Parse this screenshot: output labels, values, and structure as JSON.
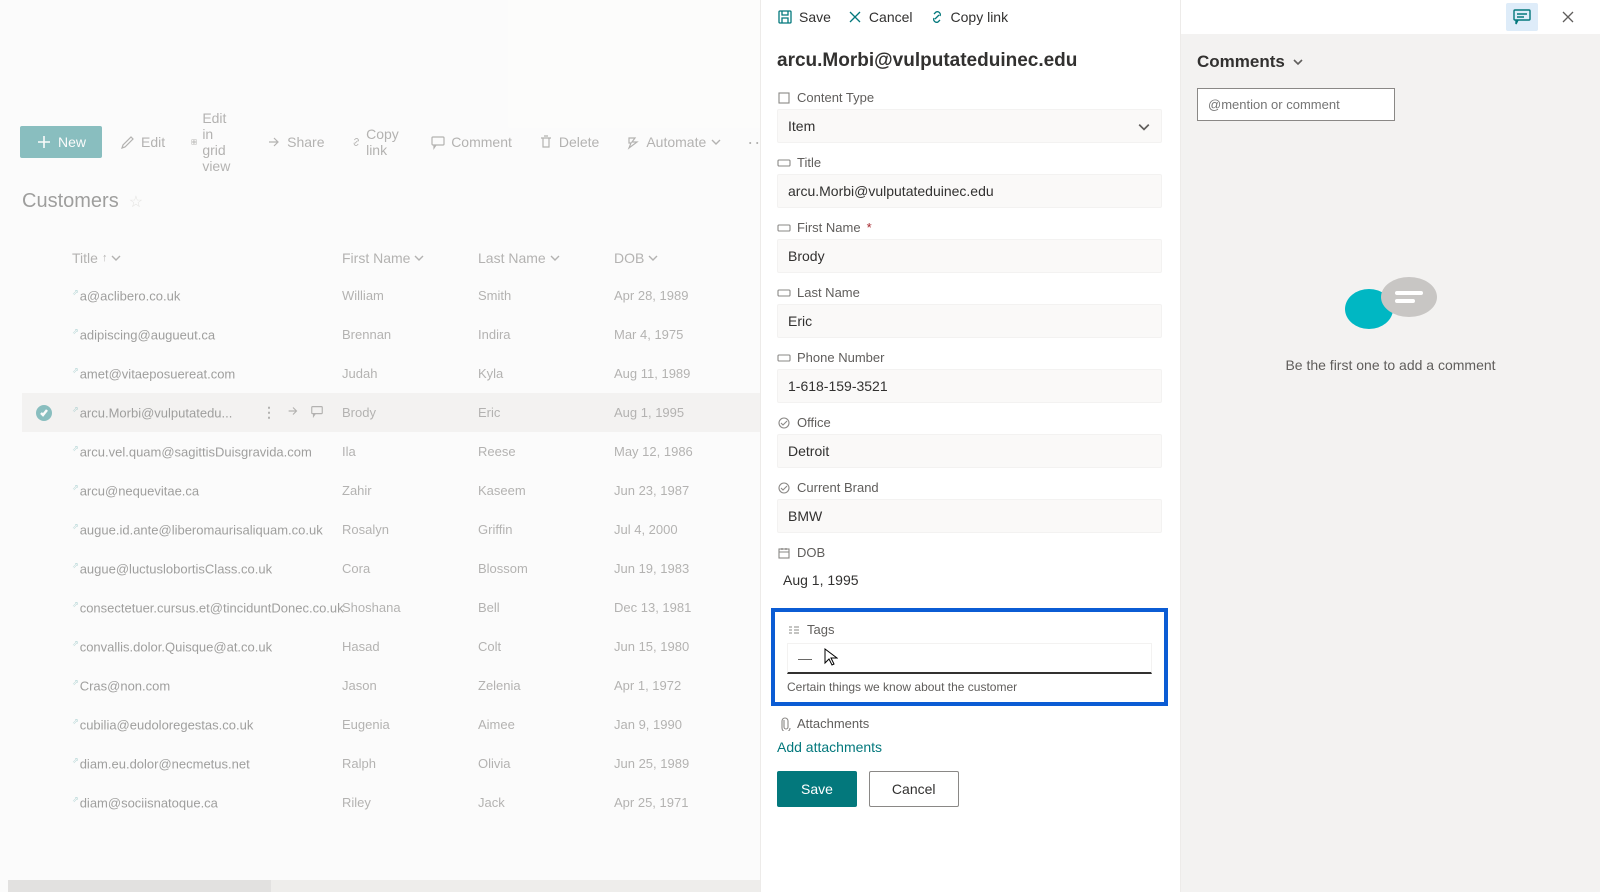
{
  "toolbar": {
    "new_label": "New",
    "edit_label": "Edit",
    "edit_grid_label": "Edit in grid view",
    "share_label": "Share",
    "copy_link_label": "Copy link",
    "comment_label": "Comment",
    "delete_label": "Delete",
    "automate_label": "Automate"
  },
  "list": {
    "title": "Customers",
    "columns": {
      "title": "Title",
      "first_name": "First Name",
      "last_name": "Last Name",
      "dob": "DOB"
    },
    "rows": [
      {
        "title": "a@aclibero.co.uk",
        "first": "William",
        "last": "Smith",
        "dob": "Apr 28, 1989"
      },
      {
        "title": "adipiscing@augueut.ca",
        "first": "Brennan",
        "last": "Indira",
        "dob": "Mar 4, 1975"
      },
      {
        "title": "amet@vitaeposuereat.com",
        "first": "Judah",
        "last": "Kyla",
        "dob": "Aug 11, 1989"
      },
      {
        "title": "arcu.Morbi@vulputatedu...",
        "first": "Brody",
        "last": "Eric",
        "dob": "Aug 1, 1995",
        "selected": true
      },
      {
        "title": "arcu.vel.quam@sagittisDuisgravida.com",
        "first": "Ila",
        "last": "Reese",
        "dob": "May 12, 1986"
      },
      {
        "title": "arcu@nequevitae.ca",
        "first": "Zahir",
        "last": "Kaseem",
        "dob": "Jun 23, 1987"
      },
      {
        "title": "augue.id.ante@liberomaurisaliquam.co.uk",
        "first": "Rosalyn",
        "last": "Griffin",
        "dob": "Jul 4, 2000"
      },
      {
        "title": "augue@luctuslobortisClass.co.uk",
        "first": "Cora",
        "last": "Blossom",
        "dob": "Jun 19, 1983"
      },
      {
        "title": "consectetuer.cursus.et@tinciduntDonec.co.uk",
        "first": "Shoshana",
        "last": "Bell",
        "dob": "Dec 13, 1981"
      },
      {
        "title": "convallis.dolor.Quisque@at.co.uk",
        "first": "Hasad",
        "last": "Colt",
        "dob": "Jun 15, 1980"
      },
      {
        "title": "Cras@non.com",
        "first": "Jason",
        "last": "Zelenia",
        "dob": "Apr 1, 1972"
      },
      {
        "title": "cubilia@eudoloregestas.co.uk",
        "first": "Eugenia",
        "last": "Aimee",
        "dob": "Jan 9, 1990"
      },
      {
        "title": "diam.eu.dolor@necmetus.net",
        "first": "Ralph",
        "last": "Olivia",
        "dob": "Jun 25, 1989"
      },
      {
        "title": "diam@sociisnatoque.ca",
        "first": "Riley",
        "last": "Jack",
        "dob": "Apr 25, 1971"
      }
    ]
  },
  "panel": {
    "top": {
      "save": "Save",
      "cancel": "Cancel",
      "copy_link": "Copy link"
    },
    "title": "arcu.Morbi@vulputateduinec.edu",
    "fields": {
      "content_type": {
        "label": "Content Type",
        "value": "Item"
      },
      "title": {
        "label": "Title",
        "value": "arcu.Morbi@vulputateduinec.edu"
      },
      "first_name": {
        "label": "First Name",
        "req": "*",
        "value": "Brody"
      },
      "last_name": {
        "label": "Last Name",
        "value": "Eric"
      },
      "phone": {
        "label": "Phone Number",
        "value": "1-618-159-3521"
      },
      "office": {
        "label": "Office",
        "value": "Detroit"
      },
      "brand": {
        "label": "Current Brand",
        "value": "BMW"
      },
      "dob": {
        "label": "DOB",
        "value": "Aug 1, 1995"
      },
      "tags": {
        "label": "Tags",
        "value": "—",
        "help": "Certain things we know about the customer"
      },
      "attachments": {
        "label": "Attachments",
        "add": "Add attachments"
      }
    },
    "buttons": {
      "save": "Save",
      "cancel": "Cancel"
    }
  },
  "comments": {
    "header": "Comments",
    "placeholder": "@mention or comment",
    "empty": "Be the first one to add a comment"
  }
}
